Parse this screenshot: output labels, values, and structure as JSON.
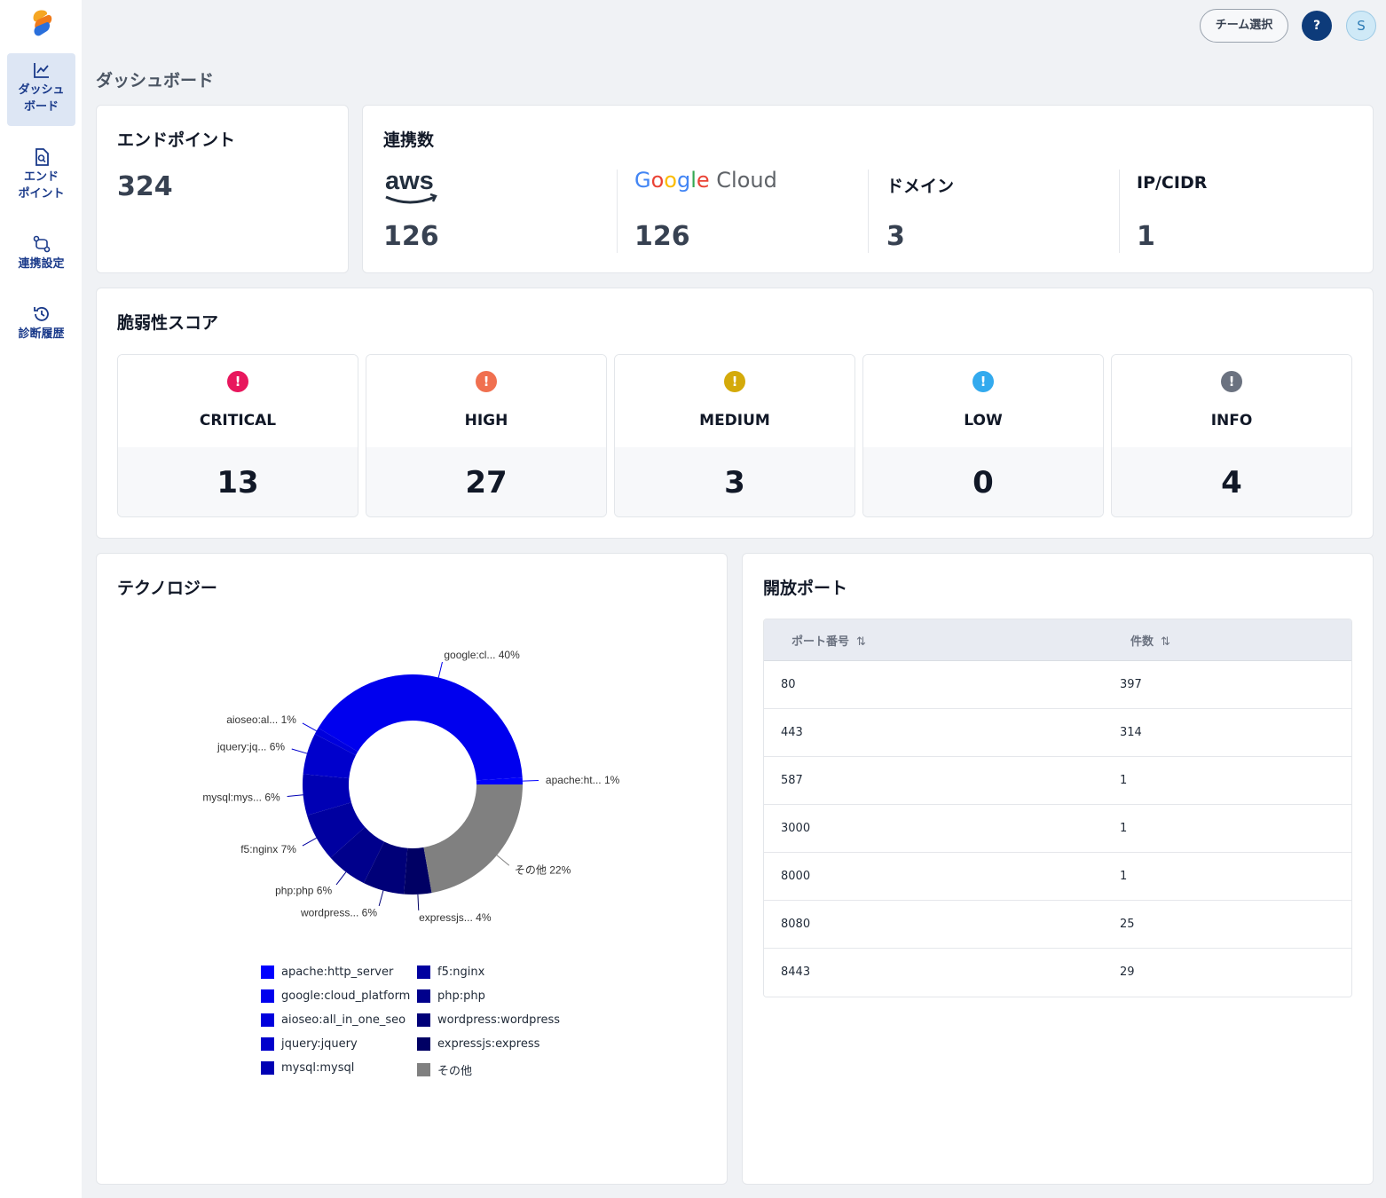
{
  "sidebar": {
    "items": [
      {
        "label": "ダッシュ\nボード",
        "icon": "chart-line-icon",
        "active": true
      },
      {
        "label": "エンド\nポイント",
        "icon": "document-search-icon",
        "active": false
      },
      {
        "label": "連携設定",
        "icon": "git-compare-icon",
        "active": false
      },
      {
        "label": "診断履歴",
        "icon": "history-icon",
        "active": false
      }
    ]
  },
  "header": {
    "team_button": "チーム選択",
    "help": "?",
    "avatar": "S"
  },
  "page_title": "ダッシュボード",
  "endpoints": {
    "title": "エンドポイント",
    "count": "324"
  },
  "integrations": {
    "title": "連携数",
    "items": [
      {
        "label": "aws",
        "count": "126",
        "icon": "aws-logo"
      },
      {
        "label": "Google Cloud",
        "count": "126",
        "icon": "google-cloud-logo"
      },
      {
        "label": "ドメイン",
        "count": "3"
      },
      {
        "label": "IP/CIDR",
        "count": "1"
      }
    ]
  },
  "vulnerability": {
    "title": "脆弱性スコア",
    "levels": [
      {
        "label": "CRITICAL",
        "count": "13",
        "color": "#e8175d",
        "icon": "!"
      },
      {
        "label": "HIGH",
        "count": "27",
        "color": "#f07050",
        "icon": "!"
      },
      {
        "label": "MEDIUM",
        "count": "3",
        "color": "#d4aa0a",
        "icon": "!"
      },
      {
        "label": "LOW",
        "count": "0",
        "color": "#33aaee",
        "icon": "!"
      },
      {
        "label": "INFO",
        "count": "4",
        "color": "#6b7280",
        "icon": "!"
      }
    ]
  },
  "technology": {
    "title": "テクノロジー"
  },
  "chart_data": {
    "type": "pie",
    "donut": true,
    "categories": [
      "apache:http_server",
      "google:cloud_platform",
      "aioseo:all_in_one_seo",
      "jquery:jquery",
      "mysql:mysql",
      "f5:nginx",
      "php:php",
      "wordpress:wordpress",
      "expressjs:express",
      "その他"
    ],
    "slice_labels": [
      "apache:ht... 1%",
      "google:cl... 40%",
      "aioseo:al... 1%",
      "jquery:jq... 6%",
      "mysql:mys... 6%",
      "f5:nginx 7%",
      "php:php 6%",
      "wordpress... 6%",
      "expressjs... 4%",
      "その他 22%"
    ],
    "values": [
      1,
      40,
      1,
      6,
      6,
      7,
      6,
      6,
      4,
      22
    ],
    "colors": [
      "#0000ff",
      "#0000ee",
      "#0000dd",
      "#0000cc",
      "#0000b4",
      "#0000a0",
      "#00008c",
      "#000078",
      "#000064",
      "#808080"
    ],
    "legend_position": "bottom"
  },
  "ports": {
    "title": "開放ポート",
    "columns": [
      "ポート番号",
      "件数"
    ],
    "sort_icon": "⇅",
    "rows": [
      {
        "port": "80",
        "count": "397"
      },
      {
        "port": "443",
        "count": "314"
      },
      {
        "port": "587",
        "count": "1"
      },
      {
        "port": "3000",
        "count": "1"
      },
      {
        "port": "8000",
        "count": "1"
      },
      {
        "port": "8080",
        "count": "25"
      },
      {
        "port": "8443",
        "count": "29"
      }
    ]
  }
}
